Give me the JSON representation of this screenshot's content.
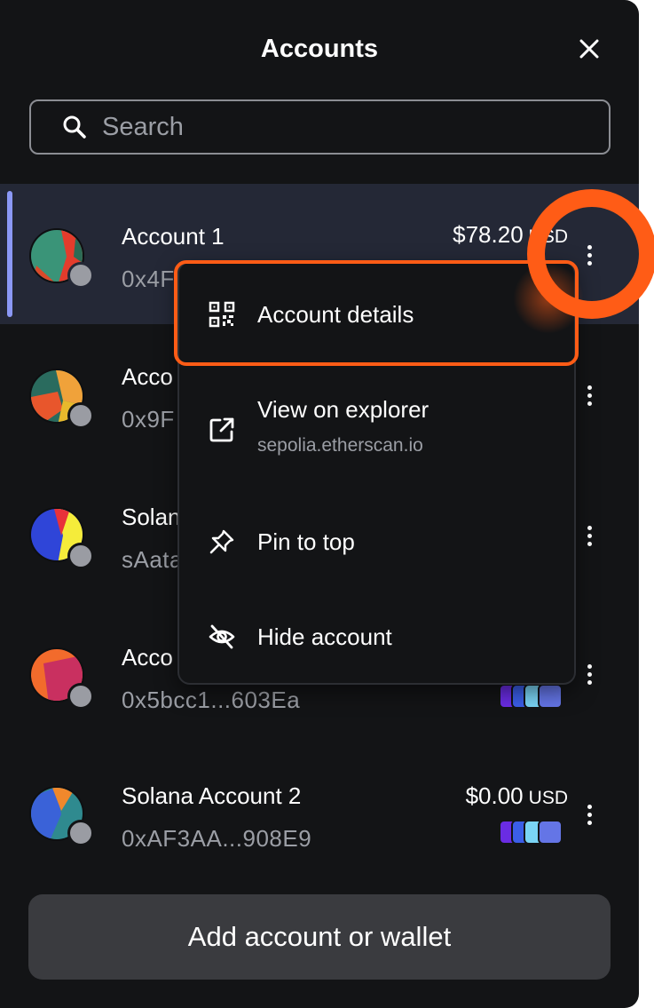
{
  "header": {
    "title": "Accounts",
    "close_icon": "close-icon"
  },
  "search": {
    "placeholder": "Search",
    "value": ""
  },
  "accounts": [
    {
      "name": "Account 1",
      "address": "0x4F",
      "balance": "$78.20",
      "currency": "USD",
      "selected": true
    },
    {
      "name": "Acco",
      "address": "0x9F"
    },
    {
      "name": "Solan",
      "address": "sAata"
    },
    {
      "name": "Acco",
      "address": "0x5bcc1...603Ea"
    },
    {
      "name": "Solana Account 2",
      "address": "0xAF3AA...908E9",
      "balance": "$0.00",
      "currency": "USD"
    }
  ],
  "context_menu": {
    "items": [
      {
        "label": "Account details",
        "icon": "qr-code-icon"
      },
      {
        "label": "View on explorer",
        "sublabel": "sepolia.etherscan.io",
        "icon": "external-link-icon"
      },
      {
        "label": "Pin to top",
        "icon": "pin-icon"
      },
      {
        "label": "Hide account",
        "icon": "eye-off-icon"
      }
    ]
  },
  "footer": {
    "add_button_label": "Add account or wallet"
  },
  "colors": {
    "background": "#131416",
    "selected_row": "#242836",
    "accent_bar": "#8b98f5",
    "highlight": "#ff5c16",
    "muted_text": "#9b9ea5"
  },
  "network_icons": [
    "d-icon",
    "e-icon",
    "l-icon",
    "ethereum-icon"
  ]
}
